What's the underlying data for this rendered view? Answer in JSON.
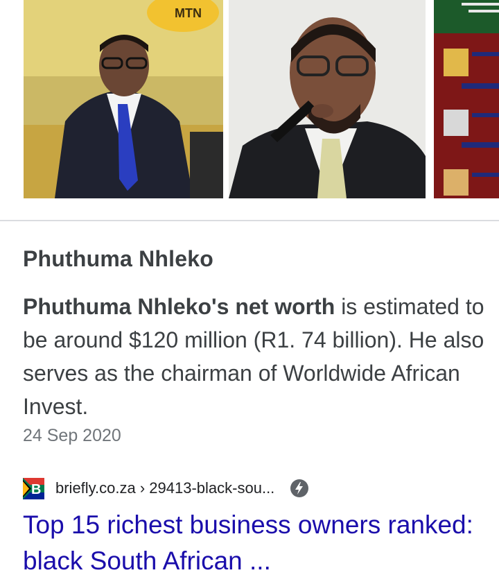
{
  "images": {
    "thumb1_alt": "Phuthuma Nhleko photo 1",
    "thumb1_sign": "MTN",
    "thumb2_alt": "Phuthuma Nhleko photo 2",
    "thumb3_alt": "Richest business owners infographic"
  },
  "result": {
    "title": "Phuthuma Nhleko",
    "snippet_bold": "Phuthuma Nhleko's net worth",
    "snippet_rest": " is estimated to be around $120 million (R1. 74 billion). He also serves as the chairman of Worldwide African Invest.",
    "date": "24 Sep 2020",
    "source_domain": "briefly.co.za",
    "source_path": " › 29413-black-sou...",
    "link_text": "Top 15 richest business owners ranked: black South African ..."
  },
  "icons": {
    "favicon": "briefly-favicon",
    "amp": "amp-lightning-icon"
  },
  "colors": {
    "link": "#1a0dab",
    "text": "#3c4043",
    "meta": "#70757a",
    "divider": "#dadce0",
    "amp": "#5f6368"
  }
}
